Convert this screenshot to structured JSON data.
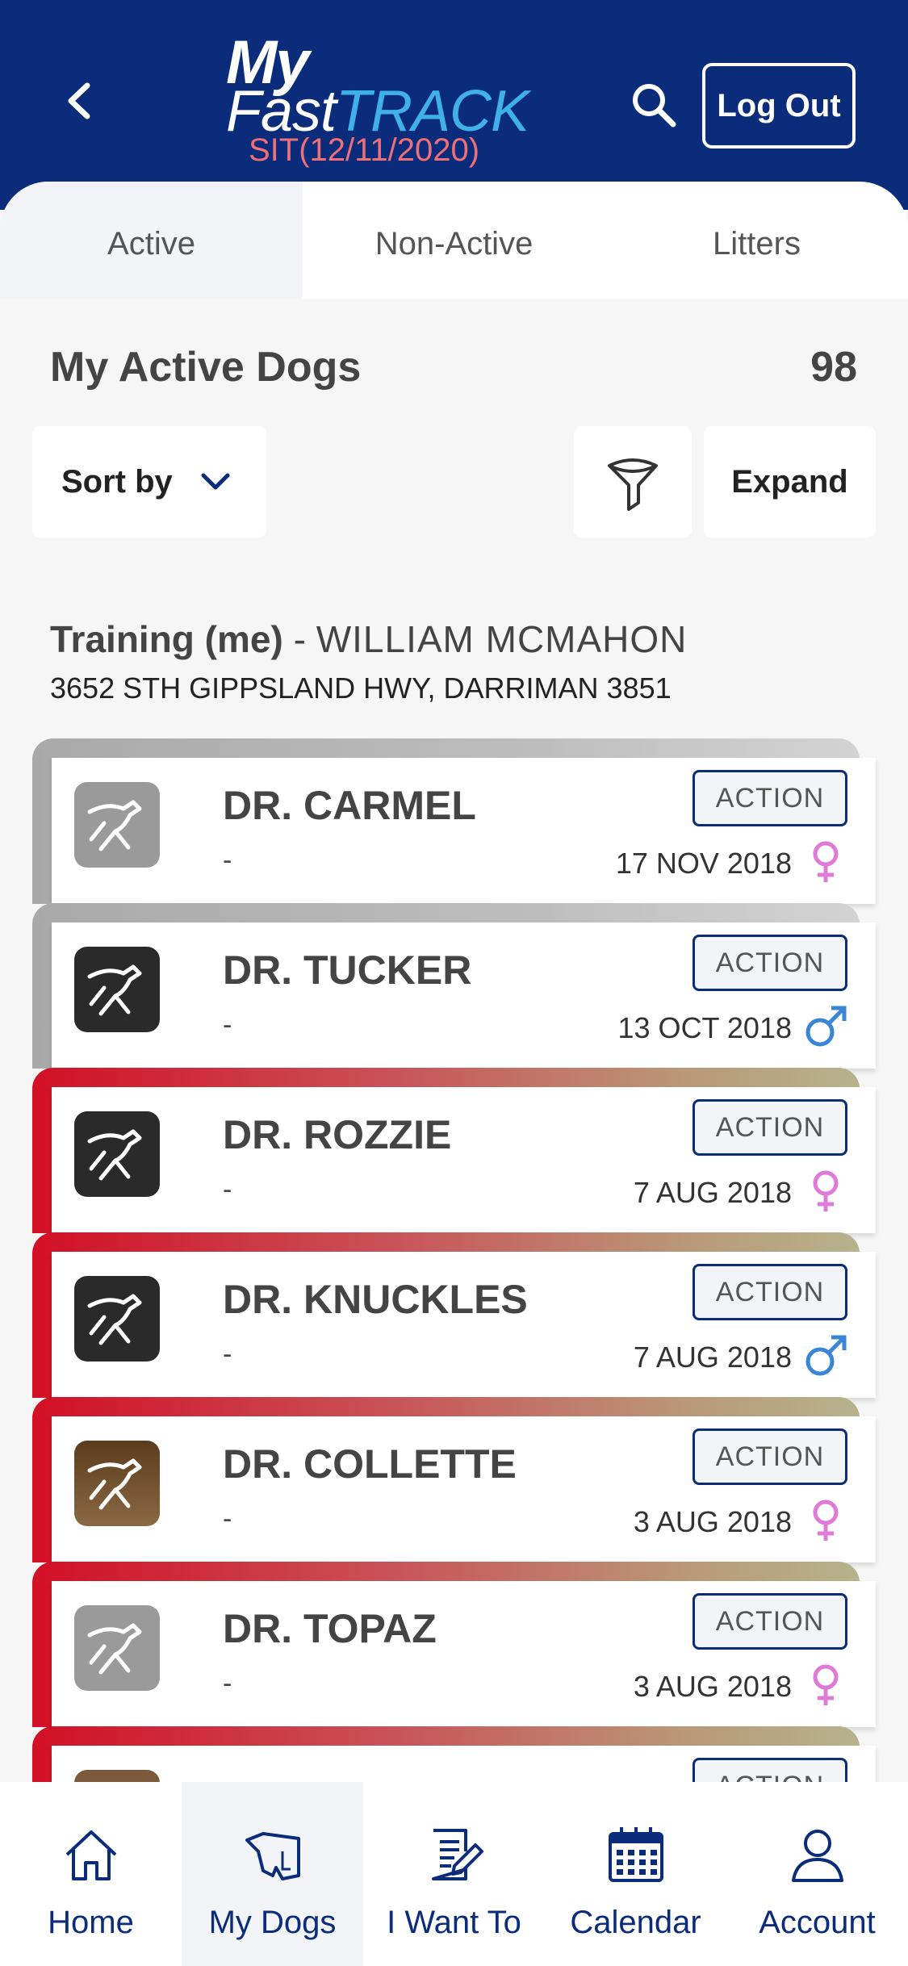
{
  "header": {
    "logo_my": "My",
    "logo_fast": "Fast",
    "logo_track": "TRACK",
    "env_label": "SIT(12/11/2020)",
    "logout_label": "Log Out",
    "back_icon": "chevron-left-icon",
    "search_icon": "search-icon"
  },
  "tabs": [
    {
      "label": "Active",
      "active": true
    },
    {
      "label": "Non-Active",
      "active": false
    },
    {
      "label": "Litters",
      "active": false
    }
  ],
  "section": {
    "title": "My Active Dogs",
    "count": "98",
    "sort_label": "Sort by",
    "expand_label": "Expand",
    "filter_icon": "filter-icon"
  },
  "trainer": {
    "role": "Training (me)",
    "separator": " - ",
    "name": "WILLIAM MCMAHON",
    "address": "3652 STH GIPPSLAND HWY, DARRIMAN 3851"
  },
  "dogs": [
    {
      "name": "DR. CARMEL",
      "sub": "-",
      "date": "17 NOV 2018",
      "sex": "female",
      "action": "ACTION",
      "bar": "grey",
      "avatar": "grey"
    },
    {
      "name": "DR. TUCKER",
      "sub": "-",
      "date": "13 OCT 2018",
      "sex": "male",
      "action": "ACTION",
      "bar": "grey",
      "avatar": "black"
    },
    {
      "name": "DR. ROZZIE",
      "sub": "-",
      "date": "7 AUG 2018",
      "sex": "female",
      "action": "ACTION",
      "bar": "red",
      "avatar": "black"
    },
    {
      "name": "DR. KNUCKLES",
      "sub": "-",
      "date": "7 AUG 2018",
      "sex": "male",
      "action": "ACTION",
      "bar": "red",
      "avatar": "black"
    },
    {
      "name": "DR. COLLETTE",
      "sub": "-",
      "date": "3 AUG 2018",
      "sex": "female",
      "action": "ACTION",
      "bar": "red",
      "avatar": "brindle"
    },
    {
      "name": "DR. TOPAZ",
      "sub": "-",
      "date": "3 AUG 2018",
      "sex": "female",
      "action": "ACTION",
      "bar": "red",
      "avatar": "grey"
    },
    {
      "name": "",
      "sub": "",
      "date": "",
      "sex": "",
      "action": "ACTION",
      "bar": "red",
      "avatar": "brown"
    }
  ],
  "bottom_nav": [
    {
      "label": "Home",
      "icon": "home-icon",
      "active": false
    },
    {
      "label": "My Dogs",
      "icon": "dog-map-icon",
      "active": true
    },
    {
      "label": "I Want To",
      "icon": "document-edit-icon",
      "active": false
    },
    {
      "label": "Calendar",
      "icon": "calendar-icon",
      "active": false
    },
    {
      "label": "Account",
      "icon": "user-icon",
      "active": false
    }
  ],
  "colors": {
    "primary": "#0b2c7a",
    "accent_blue": "#3fb1e8",
    "env_red": "#ef6f78",
    "female": "#e07ad8",
    "male": "#3a86d6"
  }
}
